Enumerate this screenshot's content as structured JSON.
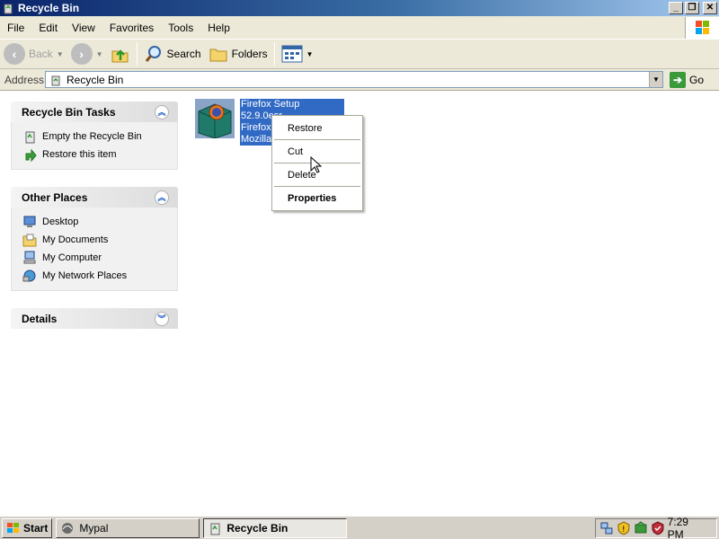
{
  "window": {
    "title": "Recycle Bin",
    "controls": [
      "_",
      "❐",
      "✕"
    ]
  },
  "menu": [
    "File",
    "Edit",
    "View",
    "Favorites",
    "Tools",
    "Help"
  ],
  "toolbar": {
    "back_label": "Back",
    "search_label": "Search",
    "folders_label": "Folders"
  },
  "address": {
    "label": "Address",
    "value": "Recycle Bin",
    "go_label": "Go"
  },
  "tasks_panel": {
    "title": "Recycle Bin Tasks",
    "items": [
      {
        "label": "Empty the Recycle Bin",
        "icon": "recycle-bin-icon"
      },
      {
        "label": "Restore this item",
        "icon": "restore-icon"
      }
    ]
  },
  "places_panel": {
    "title": "Other Places",
    "items": [
      {
        "label": "Desktop",
        "icon": "desktop-icon"
      },
      {
        "label": "My Documents",
        "icon": "my-documents-icon"
      },
      {
        "label": "My Computer",
        "icon": "my-computer-icon"
      },
      {
        "label": "My Network Places",
        "icon": "network-places-icon"
      }
    ]
  },
  "details_panel": {
    "title": "Details"
  },
  "file": {
    "lines": [
      "Firefox Setup 52.9.0esr",
      "Firefox",
      "Mozilla"
    ]
  },
  "context_menu": {
    "items": [
      "Restore",
      "Cut",
      "Delete",
      "Properties"
    ]
  },
  "taskbar": {
    "start_label": "Start",
    "tasks": [
      {
        "label": "Mypal",
        "active": false
      },
      {
        "label": "Recycle Bin",
        "active": true
      }
    ],
    "clock": "7:29 PM"
  }
}
